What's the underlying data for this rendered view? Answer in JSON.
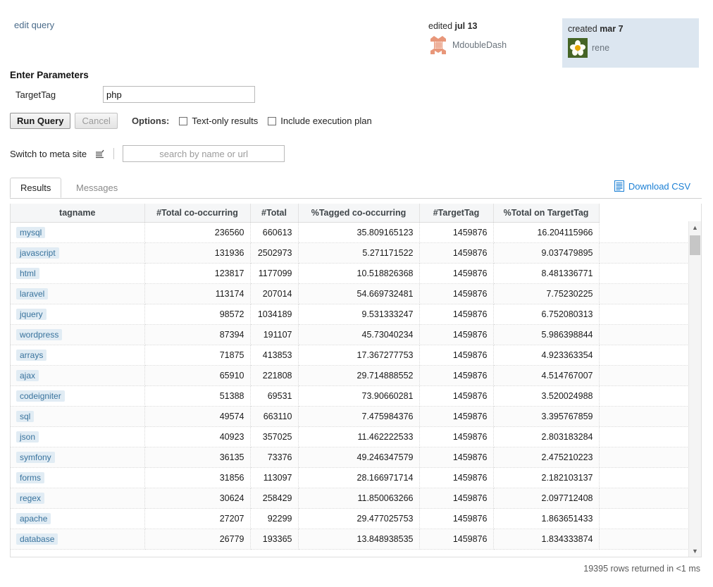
{
  "header": {
    "edit_query_label": "edit query",
    "edited": {
      "prefix": "edited",
      "date": "jul 13",
      "username": "MdoubleDash",
      "avatar_icon": "user-avatar-icon"
    },
    "created": {
      "prefix": "created",
      "date": "mar 7",
      "username": "rene",
      "avatar_icon": "flower-avatar-icon"
    }
  },
  "parameters": {
    "section_title": "Enter Parameters",
    "fields": [
      {
        "label": "TargetTag",
        "value": "php",
        "placeholder": ""
      }
    ]
  },
  "actions": {
    "run_label": "Run Query",
    "cancel_label": "Cancel",
    "options_label": "Options:",
    "checkboxes": [
      {
        "label": "Text-only results",
        "checked": false
      },
      {
        "label": "Include execution plan",
        "checked": false
      }
    ]
  },
  "meta_switch": {
    "label": "Switch to meta site",
    "icon": "stack-exchange-icon",
    "search_placeholder": "search by name or url",
    "search_value": ""
  },
  "results_panel": {
    "tabs": [
      {
        "label": "Results",
        "active": true
      },
      {
        "label": "Messages",
        "active": false
      }
    ],
    "download_label": "Download CSV",
    "download_icon": "csv-file-icon",
    "status": "19395 rows returned in <1 ms"
  },
  "table": {
    "columns": [
      "tagname",
      "#Total co-occurring",
      "#Total",
      "%Tagged co-occurring",
      "#TargetTag",
      "%Total on TargetTag"
    ],
    "rows": [
      {
        "tagname": "mysql",
        "total_co": "236560",
        "total": "660613",
        "pct_tagged": "35.809165123",
        "target": "1459876",
        "pct_total": "16.204115966"
      },
      {
        "tagname": "javascript",
        "total_co": "131936",
        "total": "2502973",
        "pct_tagged": "5.271171522",
        "target": "1459876",
        "pct_total": "9.037479895"
      },
      {
        "tagname": "html",
        "total_co": "123817",
        "total": "1177099",
        "pct_tagged": "10.518826368",
        "target": "1459876",
        "pct_total": "8.481336771"
      },
      {
        "tagname": "laravel",
        "total_co": "113174",
        "total": "207014",
        "pct_tagged": "54.669732481",
        "target": "1459876",
        "pct_total": "7.75230225"
      },
      {
        "tagname": "jquery",
        "total_co": "98572",
        "total": "1034189",
        "pct_tagged": "9.531333247",
        "target": "1459876",
        "pct_total": "6.752080313"
      },
      {
        "tagname": "wordpress",
        "total_co": "87394",
        "total": "191107",
        "pct_tagged": "45.73040234",
        "target": "1459876",
        "pct_total": "5.986398844"
      },
      {
        "tagname": "arrays",
        "total_co": "71875",
        "total": "413853",
        "pct_tagged": "17.367277753",
        "target": "1459876",
        "pct_total": "4.923363354"
      },
      {
        "tagname": "ajax",
        "total_co": "65910",
        "total": "221808",
        "pct_tagged": "29.714888552",
        "target": "1459876",
        "pct_total": "4.514767007"
      },
      {
        "tagname": "codeigniter",
        "total_co": "51388",
        "total": "69531",
        "pct_tagged": "73.90660281",
        "target": "1459876",
        "pct_total": "3.520024988"
      },
      {
        "tagname": "sql",
        "total_co": "49574",
        "total": "663110",
        "pct_tagged": "7.475984376",
        "target": "1459876",
        "pct_total": "3.395767859"
      },
      {
        "tagname": "json",
        "total_co": "40923",
        "total": "357025",
        "pct_tagged": "11.462222533",
        "target": "1459876",
        "pct_total": "2.803183284"
      },
      {
        "tagname": "symfony",
        "total_co": "36135",
        "total": "73376",
        "pct_tagged": "49.246347579",
        "target": "1459876",
        "pct_total": "2.475210223"
      },
      {
        "tagname": "forms",
        "total_co": "31856",
        "total": "113097",
        "pct_tagged": "28.166971714",
        "target": "1459876",
        "pct_total": "2.182103137"
      },
      {
        "tagname": "regex",
        "total_co": "30624",
        "total": "258429",
        "pct_tagged": "11.850063266",
        "target": "1459876",
        "pct_total": "2.097712408"
      },
      {
        "tagname": "apache",
        "total_co": "27207",
        "total": "92299",
        "pct_tagged": "29.477025753",
        "target": "1459876",
        "pct_total": "1.863651433"
      },
      {
        "tagname": "database",
        "total_co": "26779",
        "total": "193365",
        "pct_tagged": "13.848938535",
        "target": "1459876",
        "pct_total": "1.834333874"
      }
    ]
  },
  "colors": {
    "link": "#1a7fd4",
    "tag_bg": "#e1ecf4",
    "tag_fg": "#39739d",
    "created_bg": "#dce6f0",
    "avatar_orange": "#e8977a"
  }
}
